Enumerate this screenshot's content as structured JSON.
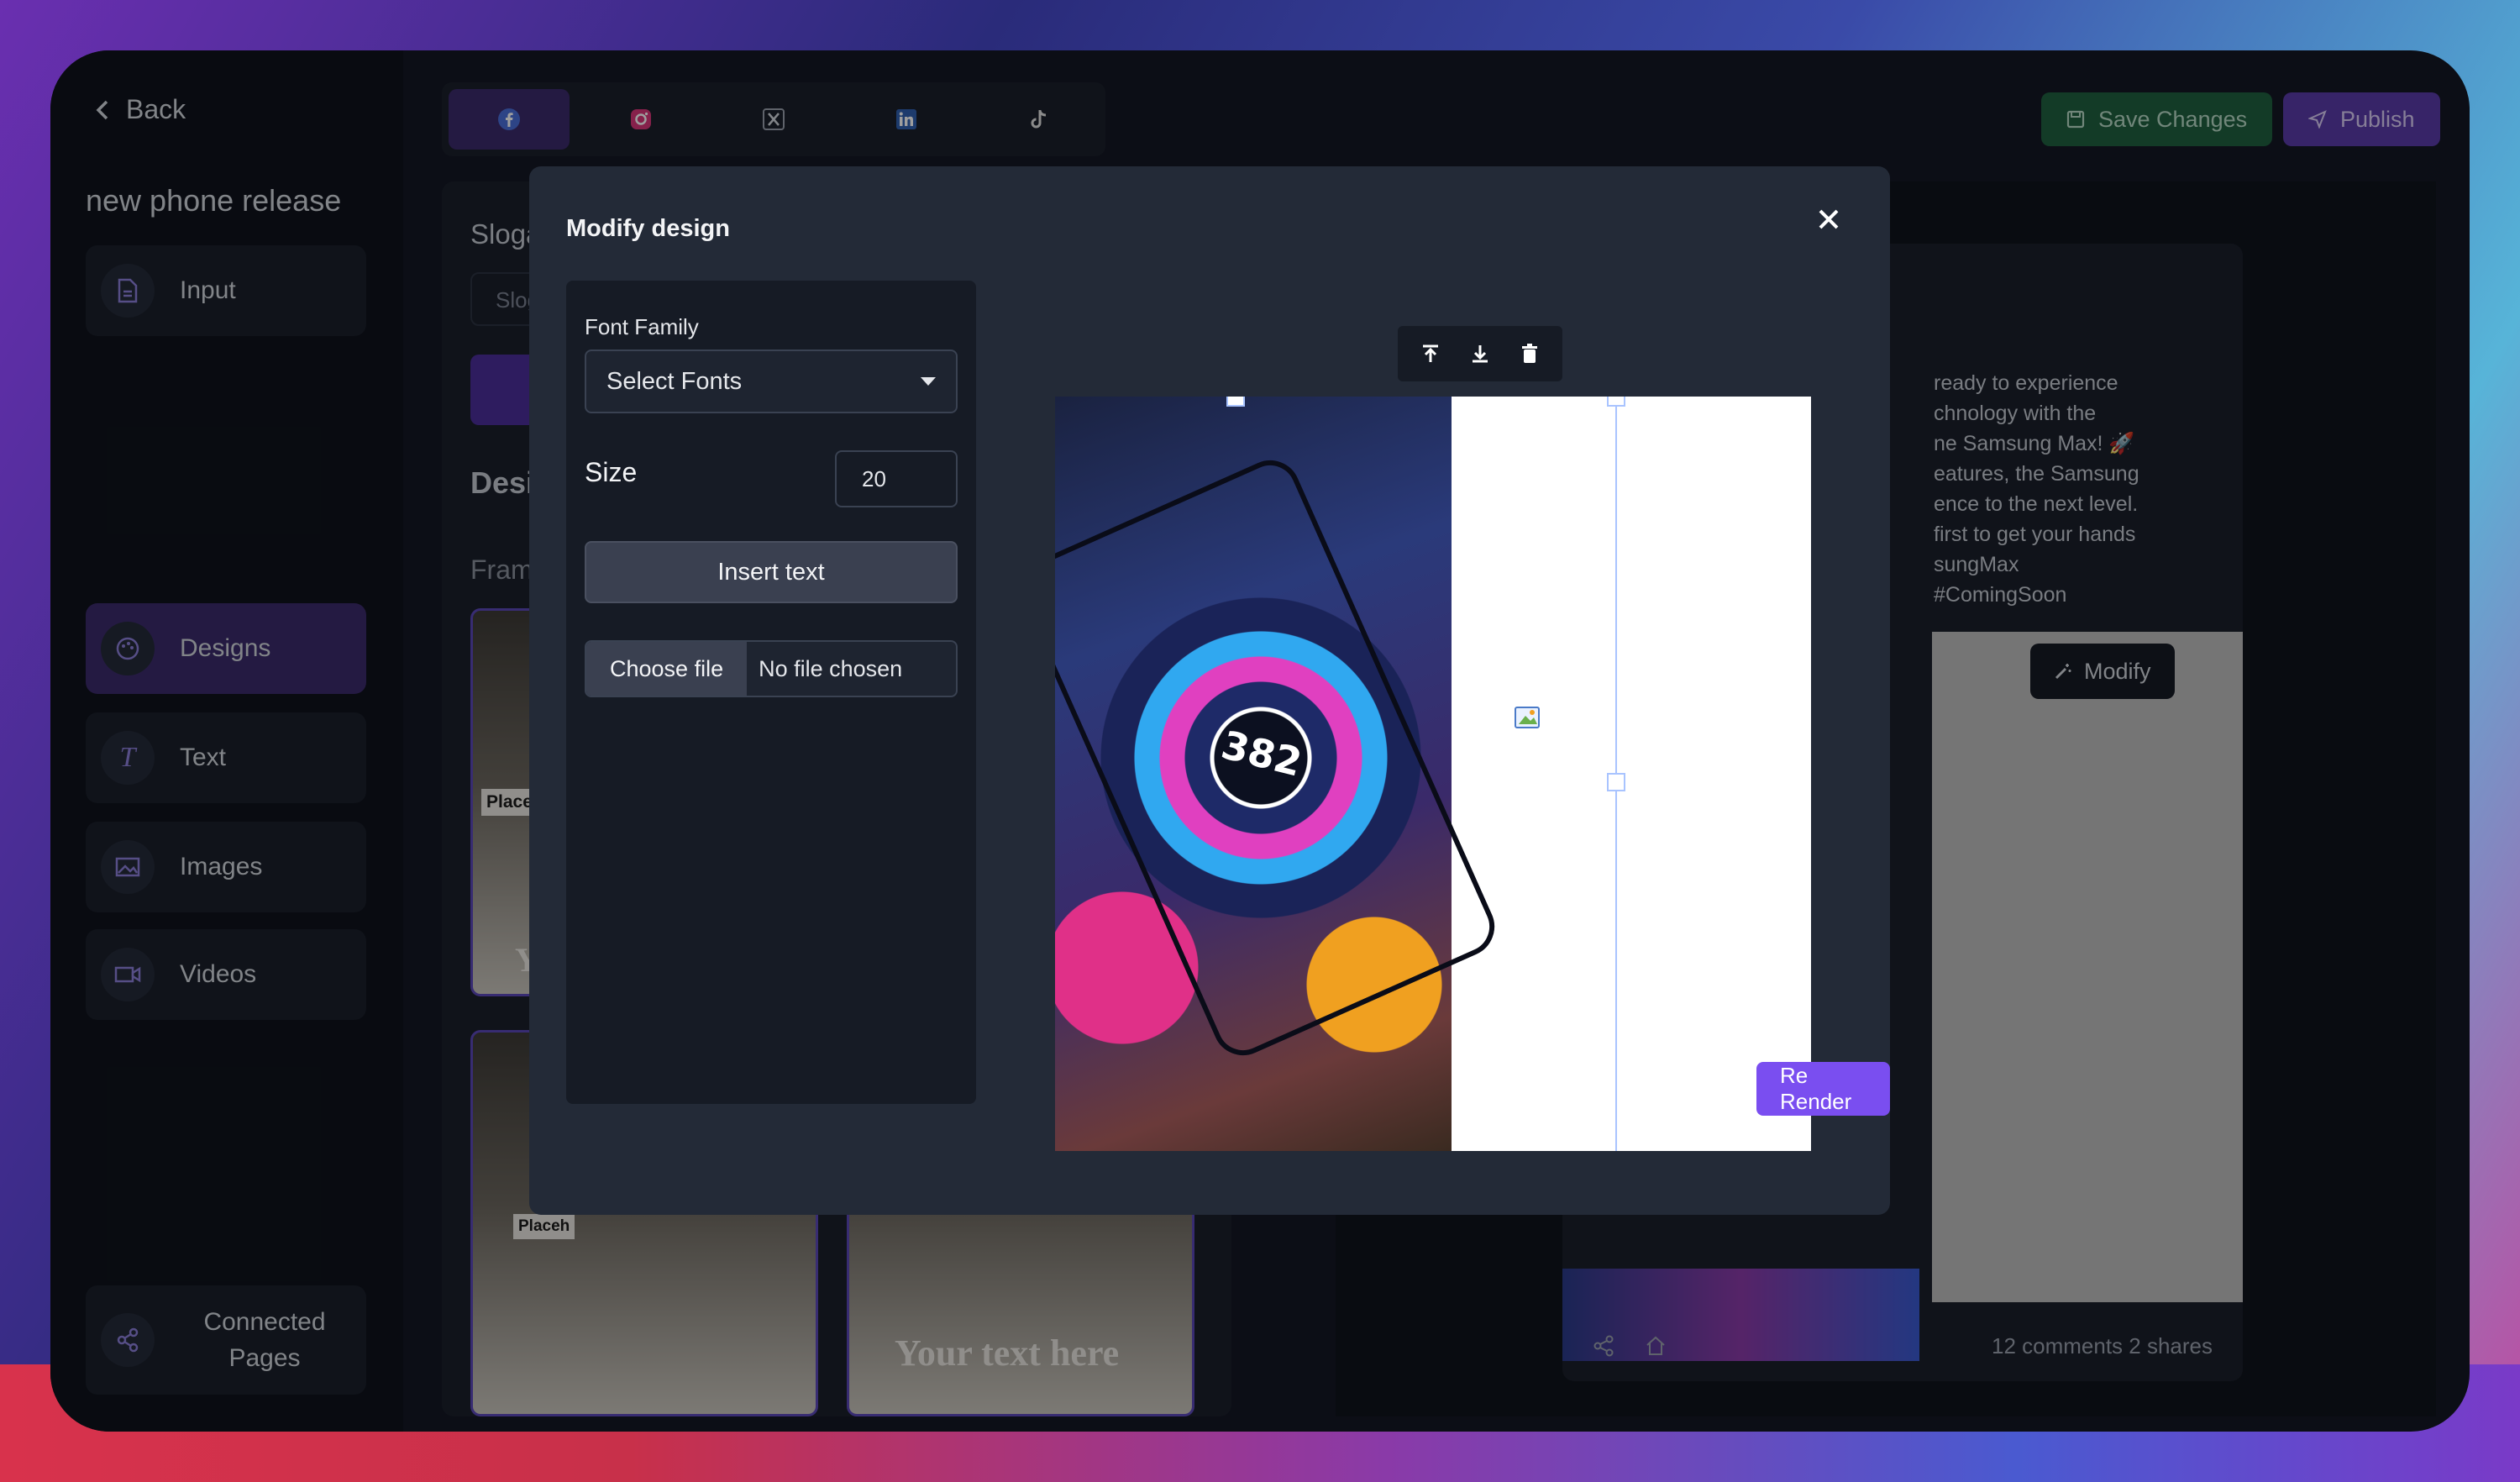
{
  "sidebar": {
    "back_label": "Back",
    "project_title": "new phone release",
    "items": [
      {
        "label": "Input",
        "icon": "document-icon"
      },
      {
        "label": "Designs",
        "icon": "palette-icon",
        "active": true
      },
      {
        "label": "Text",
        "icon": "text-icon"
      },
      {
        "label": "Images",
        "icon": "image-icon"
      },
      {
        "label": "Videos",
        "icon": "video-icon"
      }
    ],
    "connected_pages": "Connected Pages"
  },
  "social_tabs": [
    "facebook-icon",
    "instagram-icon",
    "x-icon",
    "linkedin-icon",
    "tiktok-icon"
  ],
  "toolbar": {
    "save_label": "Save Changes",
    "publish_label": "Publish"
  },
  "middle": {
    "slogan_heading": "Slogan",
    "slogan_placeholder": "Slogan",
    "designs_heading": "Designs",
    "frames_heading": "Frames",
    "thumb_placeholder_1": "Placeholder",
    "thumb_text_1": "Your",
    "thumb_placeholder_2": "Placeh",
    "thumb_text_2": "Your text here"
  },
  "post": {
    "text": "ready to experience\nchnology with the\nne Samsung Max! 🚀\neatures, the Samsung\nence to the next level.\nfirst to get your hands\nsungMax\n#ComingSoon",
    "modify_label": "Modify",
    "stats": "12 comments 2 shares"
  },
  "modal": {
    "title": "Modify design",
    "font_family_label": "Font Family",
    "font_select_value": "Select Fonts",
    "size_label": "Size",
    "size_value": "20",
    "insert_text_label": "Insert text",
    "choose_file_label": "Choose file",
    "no_file_label": "No file chosen",
    "rerender_label": "Re Render",
    "artwork_number": "382"
  },
  "colors": {
    "accent": "#7a4ef0",
    "active_item": "#3b2a6b",
    "save": "#1f5f3f"
  }
}
